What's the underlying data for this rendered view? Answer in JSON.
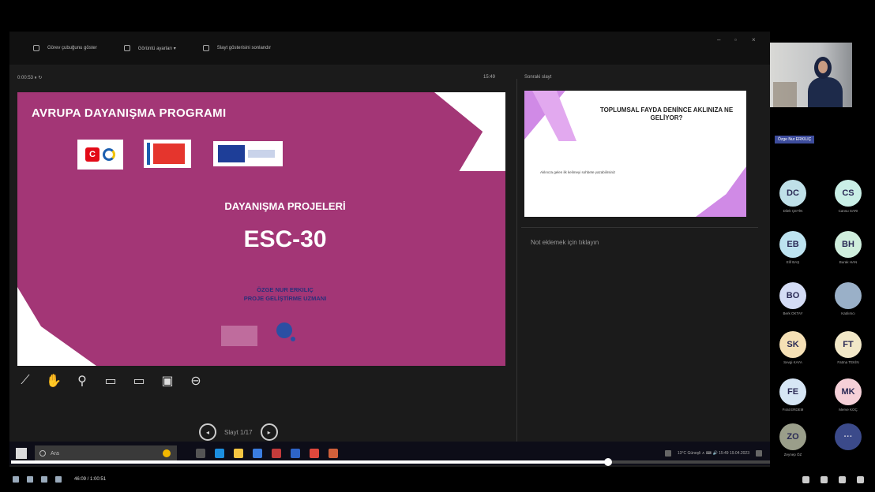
{
  "toolbar": {
    "items": [
      {
        "label": "Görev çubuğunu göster",
        "icon": "taskbar-icon"
      },
      {
        "label": "Görüntü ayarları ▾",
        "icon": "display-icon"
      },
      {
        "label": "Slayt gösterisini sonlandır",
        "icon": "end-show-icon"
      }
    ],
    "window_controls": [
      "–",
      "▫",
      "×"
    ]
  },
  "presenter": {
    "timer_label": "0:00:53  ⏸  ↻",
    "clock": "15:49",
    "next_label": "Sonraki slayt"
  },
  "slide": {
    "title": "AVRUPA DAYANIŞMA PROGRAMI",
    "turkey_letter": "C",
    "subtitle": "DAYANIŞMA PROJELERİ",
    "code": "ESC-30",
    "author_name": "ÖZGE NUR ERKILIÇ",
    "author_role": "PROJE GELİŞTİRME UZMANI"
  },
  "next_slide": {
    "heading": "TOPLUMSAL FAYDA DENİNCE AKLINIZA NE GELİYOR?",
    "line": "Aklınıza gelen ilk kelimeyi sohbete yazabilirsiniz"
  },
  "notes_placeholder": "Not eklemek için tıklayın",
  "tools": [
    {
      "name": "pen-icon",
      "glyph": "⟋"
    },
    {
      "name": "laser-icon",
      "glyph": "✋"
    },
    {
      "name": "zoom-icon",
      "glyph": "⚲"
    },
    {
      "name": "camera-toggle-icon",
      "glyph": "▭"
    },
    {
      "name": "blackscreen-icon",
      "glyph": "▭"
    },
    {
      "name": "subtitles-icon",
      "glyph": "▣"
    },
    {
      "name": "more-icon",
      "glyph": "⊖"
    }
  ],
  "navigation": {
    "prev_glyph": "◂",
    "next_glyph": "▸",
    "label": "Slayt 1/17"
  },
  "taskbar": {
    "search_placeholder": "Ara",
    "tray_text": "13°C Güneşli  ∧  ⌨  🔊  15:49  19.04.2023"
  },
  "video": {
    "progress_fraction": 0.7,
    "time": "46:09 / 1:00:51"
  },
  "participants": {
    "presenter_name": "Özge Nur ERKILIÇ",
    "avatars": [
      {
        "initials": "DC",
        "name": "Dilek ÇETİN",
        "color": "#bfe0e8"
      },
      {
        "initials": "CS",
        "name": "Cansu SARI",
        "color": "#c9efe6"
      },
      {
        "initials": "EB",
        "name": "Elif BAŞ",
        "color": "#bde3f0"
      },
      {
        "initials": "BH",
        "name": "Burak HAN",
        "color": "#cfeedd"
      },
      {
        "initials": "BO",
        "name": "Berk OKTAY",
        "color": "#d4dcf5"
      },
      {
        "initials": "",
        "name": "Katılımcı",
        "color": "#9ab0c8"
      },
      {
        "initials": "SK",
        "name": "Sevgi KAYA",
        "color": "#f5e0b5"
      },
      {
        "initials": "FT",
        "name": "Fatma TEKİN",
        "color": "#f2e8c8"
      },
      {
        "initials": "FE",
        "name": "Fırat ERDEM",
        "color": "#d6e6f5"
      },
      {
        "initials": "MK",
        "name": "Merve KOÇ",
        "color": "#f5d0d8"
      },
      {
        "initials": "ZO",
        "name": "Zeynep ÖZ",
        "color": "#9a9e8a"
      },
      {
        "initials": "···",
        "name": "",
        "color": "#3b4a8a"
      }
    ]
  }
}
